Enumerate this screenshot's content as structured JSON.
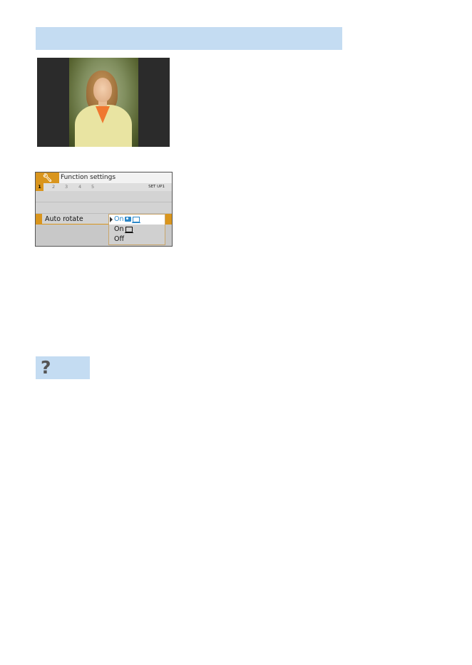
{
  "menu": {
    "tab_icon": "wrench-icon",
    "title": "Function settings",
    "tabs": [
      "1",
      "2",
      "3",
      "4",
      "5"
    ],
    "setup_label": "SET UP1",
    "item_label": "Auto rotate",
    "options": [
      {
        "label": "On",
        "icons": [
          "camera-icon",
          "computer-icon"
        ],
        "selected": true
      },
      {
        "label": "On",
        "icons": [
          "computer-icon"
        ],
        "selected": false
      },
      {
        "label": "Off",
        "icons": [],
        "selected": false
      }
    ],
    "accent_color": "#d9951d",
    "selected_text_color": "#2a87c8"
  },
  "help_badge": {
    "symbol": "?"
  },
  "colors": {
    "header_bar": "#c4dcf2"
  }
}
